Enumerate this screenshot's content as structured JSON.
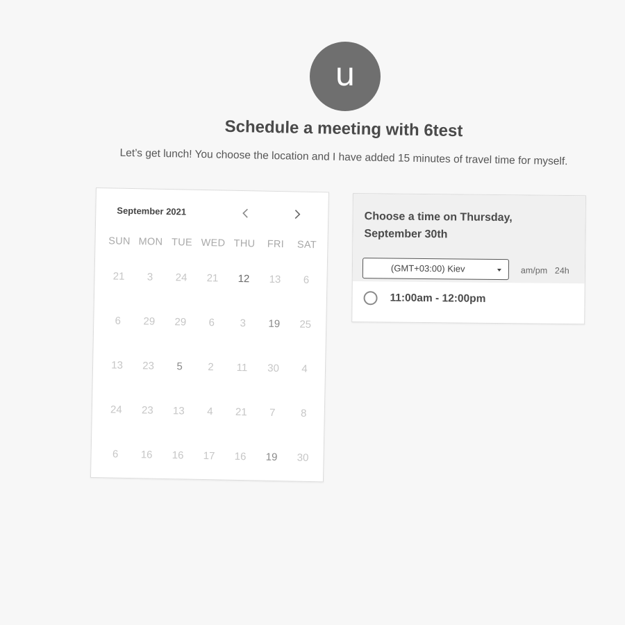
{
  "host": {
    "avatar_letter": "u",
    "title": "Schedule a meeting with 6test",
    "description": "Let’s get lunch! You choose the location and I have added 15 minutes of travel time for myself."
  },
  "calendar": {
    "month_label": "September 2021",
    "prev_icon": "chevron-left-icon",
    "next_icon": "chevron-right-icon",
    "weekdays": [
      "SUN",
      "MON",
      "TUE",
      "WED",
      "THU",
      "FRI",
      "SAT"
    ],
    "weeks": [
      [
        "21",
        "3",
        "24",
        "21",
        "12",
        "13",
        "6"
      ],
      [
        "6",
        "29",
        "29",
        "6",
        "3",
        "19",
        "25"
      ],
      [
        "13",
        "23",
        "5",
        "2",
        "11",
        "30",
        "4"
      ],
      [
        "24",
        "23",
        "13",
        "4",
        "21",
        "7",
        "8"
      ],
      [
        "6",
        "16",
        "16",
        "17",
        "16",
        "19",
        "30"
      ]
    ]
  },
  "time_picker": {
    "title": "Choose a time on Thursday, September 30th",
    "timezone": "(GMT+03:00) Kiev",
    "format_ampm": "am/pm",
    "format_24h": "24h",
    "slots": [
      {
        "label": "11:00am - 12:00pm"
      }
    ]
  }
}
